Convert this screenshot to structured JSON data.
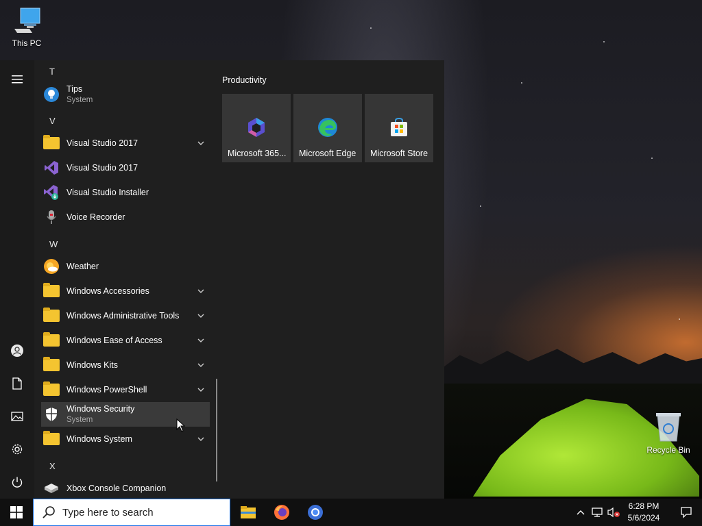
{
  "desktop": {
    "this_pc_label": "This PC",
    "recycle_bin_label": "Recycle Bin"
  },
  "start_menu": {
    "rail": {
      "items": [
        {
          "name": "expand-menu",
          "icon": "hamburger-icon"
        },
        {
          "name": "account",
          "icon": "user-icon"
        },
        {
          "name": "documents",
          "icon": "document-icon"
        },
        {
          "name": "pictures",
          "icon": "pictures-icon"
        },
        {
          "name": "settings",
          "icon": "gear-icon"
        },
        {
          "name": "power",
          "icon": "power-icon"
        }
      ]
    },
    "app_list": {
      "letters": [
        "T",
        "V",
        "W",
        "X"
      ],
      "apps": [
        {
          "label": "Tips",
          "sub": "System",
          "icon": "lightbulb-icon"
        },
        {
          "label": "Visual Studio 2017",
          "icon": "folder-icon",
          "expandable": true
        },
        {
          "label": "Visual Studio 2017",
          "icon": "visual-studio-icon"
        },
        {
          "label": "Visual Studio Installer",
          "icon": "visual-studio-installer-icon"
        },
        {
          "label": "Voice Recorder",
          "icon": "microphone-icon"
        },
        {
          "label": "Weather",
          "icon": "weather-icon"
        },
        {
          "label": "Windows Accessories",
          "icon": "folder-icon",
          "expandable": true
        },
        {
          "label": "Windows Administrative Tools",
          "icon": "folder-icon",
          "expandable": true
        },
        {
          "label": "Windows Ease of Access",
          "icon": "folder-icon",
          "expandable": true
        },
        {
          "label": "Windows Kits",
          "icon": "folder-icon",
          "expandable": true
        },
        {
          "label": "Windows PowerShell",
          "icon": "folder-icon",
          "expandable": true
        },
        {
          "label": "Windows Security",
          "sub": "System",
          "icon": "shield-icon",
          "hovered": true
        },
        {
          "label": "Windows System",
          "icon": "folder-icon",
          "expandable": true
        },
        {
          "label": "Xbox Console Companion",
          "icon": "xbox-icon"
        }
      ]
    },
    "tiles": {
      "group_title": "Productivity",
      "items": [
        {
          "label": "Microsoft 365...",
          "icon": "microsoft-365-icon"
        },
        {
          "label": "Microsoft Edge",
          "icon": "edge-icon"
        },
        {
          "label": "Microsoft Store",
          "icon": "store-icon"
        }
      ]
    }
  },
  "taskbar": {
    "start_icon": "windows-logo-icon",
    "search_placeholder": "Type here to search",
    "pinned": [
      {
        "name": "file-explorer",
        "icon": "folder-icon"
      },
      {
        "name": "firefox",
        "icon": "firefox-icon"
      },
      {
        "name": "chrome",
        "icon": "chrome-icon"
      }
    ],
    "tray": {
      "icons": [
        "chevron-up-icon",
        "network-icon",
        "volume-muted-icon"
      ],
      "time": "6:28 PM",
      "date": "5/6/2024",
      "notification_icon": "action-center-icon"
    }
  },
  "colors": {
    "start_bg": "#1f1f1f",
    "tile_bg": "#363636",
    "hover_bg": "#3a3a3a",
    "taskbar_bg": "#101010",
    "folder": "#f4c430",
    "search_border": "#1a73e8"
  }
}
